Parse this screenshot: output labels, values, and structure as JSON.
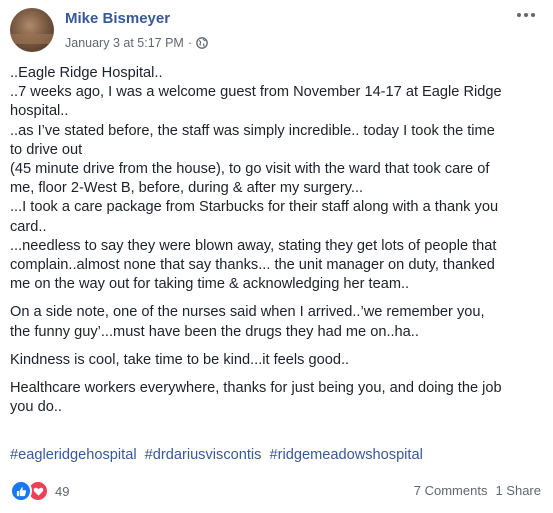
{
  "post": {
    "author": "Mike Bismeyer",
    "timestamp": "January 3 at 5:17 PM",
    "separator": "·",
    "privacy_icon": "globe-icon",
    "menu_icon": "more-options-icon",
    "body": {
      "p1": [
        "..Eagle Ridge Hospital..",
        "..7 weeks ago, I was a welcome guest from November 14-17 at Eagle Ridge",
        "hospital..",
        "..as I’ve stated before, the staff was simply incredible.. today I took the time",
        "to drive out",
        "(45 minute drive from the house), to go visit with the ward that took care of",
        "me, floor 2-West B, before, during & after my surgery...",
        "...I took a care package from Starbucks for their staff along with a thank you",
        "card..",
        "...needless to say they were blown away, stating they get lots of people that",
        "complain..almost none that say thanks... the unit manager on duty, thanked",
        "me on the way out for taking time & acknowledging her team.."
      ],
      "p2": [
        "On a side note, one of the nurses said when I arrived..’we remember you,",
        "the funny guy’...must have been the drugs they had me on..ha.."
      ],
      "p3": [
        "Kindness is cool, take time to be kind...it feels good.."
      ],
      "p4": [
        "Healthcare workers everywhere, thanks for just being you, and doing the job",
        "you do.."
      ]
    },
    "hashtags": [
      "#eagleridgehospital",
      "#drdariusviscontis",
      "#ridgemeadowshospital"
    ],
    "reactions": {
      "types": [
        "like",
        "love"
      ],
      "count": "49"
    },
    "comments_label": "7 Comments",
    "shares_label": "1 Share",
    "colors": {
      "link": "#385898",
      "secondary": "#616770",
      "like": "#1877f2",
      "love": "#f33e58"
    }
  }
}
